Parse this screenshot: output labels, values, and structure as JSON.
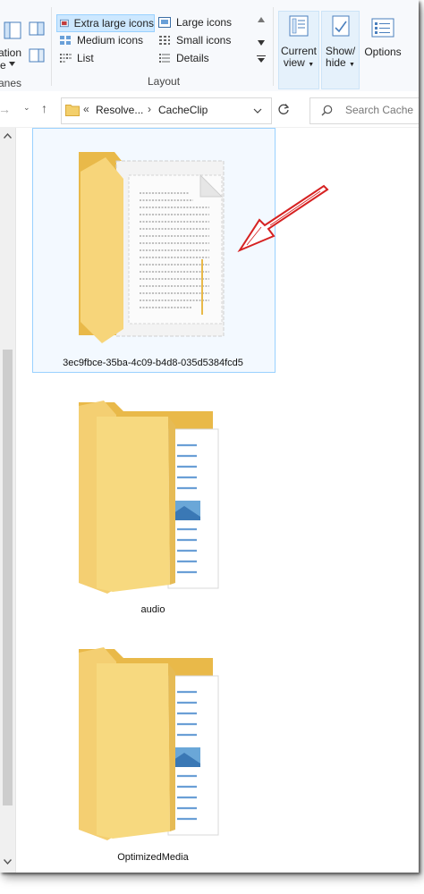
{
  "ribbon": {
    "left_label_top": "ation",
    "left_label_bottom": "e",
    "panes_label": "anes",
    "layout": {
      "group_label": "Layout",
      "extra_large": "Extra large icons",
      "large": "Large icons",
      "medium": "Medium icons",
      "small": "Small icons",
      "list": "List",
      "details": "Details"
    },
    "current_view": {
      "line1": "Current",
      "line2": "view"
    },
    "show_hide": {
      "line1": "Show/",
      "line2": "hide"
    },
    "options": "Options"
  },
  "nav": {
    "breadcrumb_prefix": "«",
    "breadcrumb_parent": "Resolve...",
    "breadcrumb_sep": "›",
    "breadcrumb_current": "CacheClip",
    "search_placeholder": "Search Cache"
  },
  "files": [
    {
      "name": "3ec9fbce-35ba-4c09-b4d8-035d5384fcd5"
    },
    {
      "name": "audio"
    },
    {
      "name": "OptimizedMedia"
    }
  ],
  "colors": {
    "folder_front": "#f7d57a",
    "folder_back": "#e9b949",
    "selection": "#cde8ff",
    "arrow": "#d62222"
  }
}
